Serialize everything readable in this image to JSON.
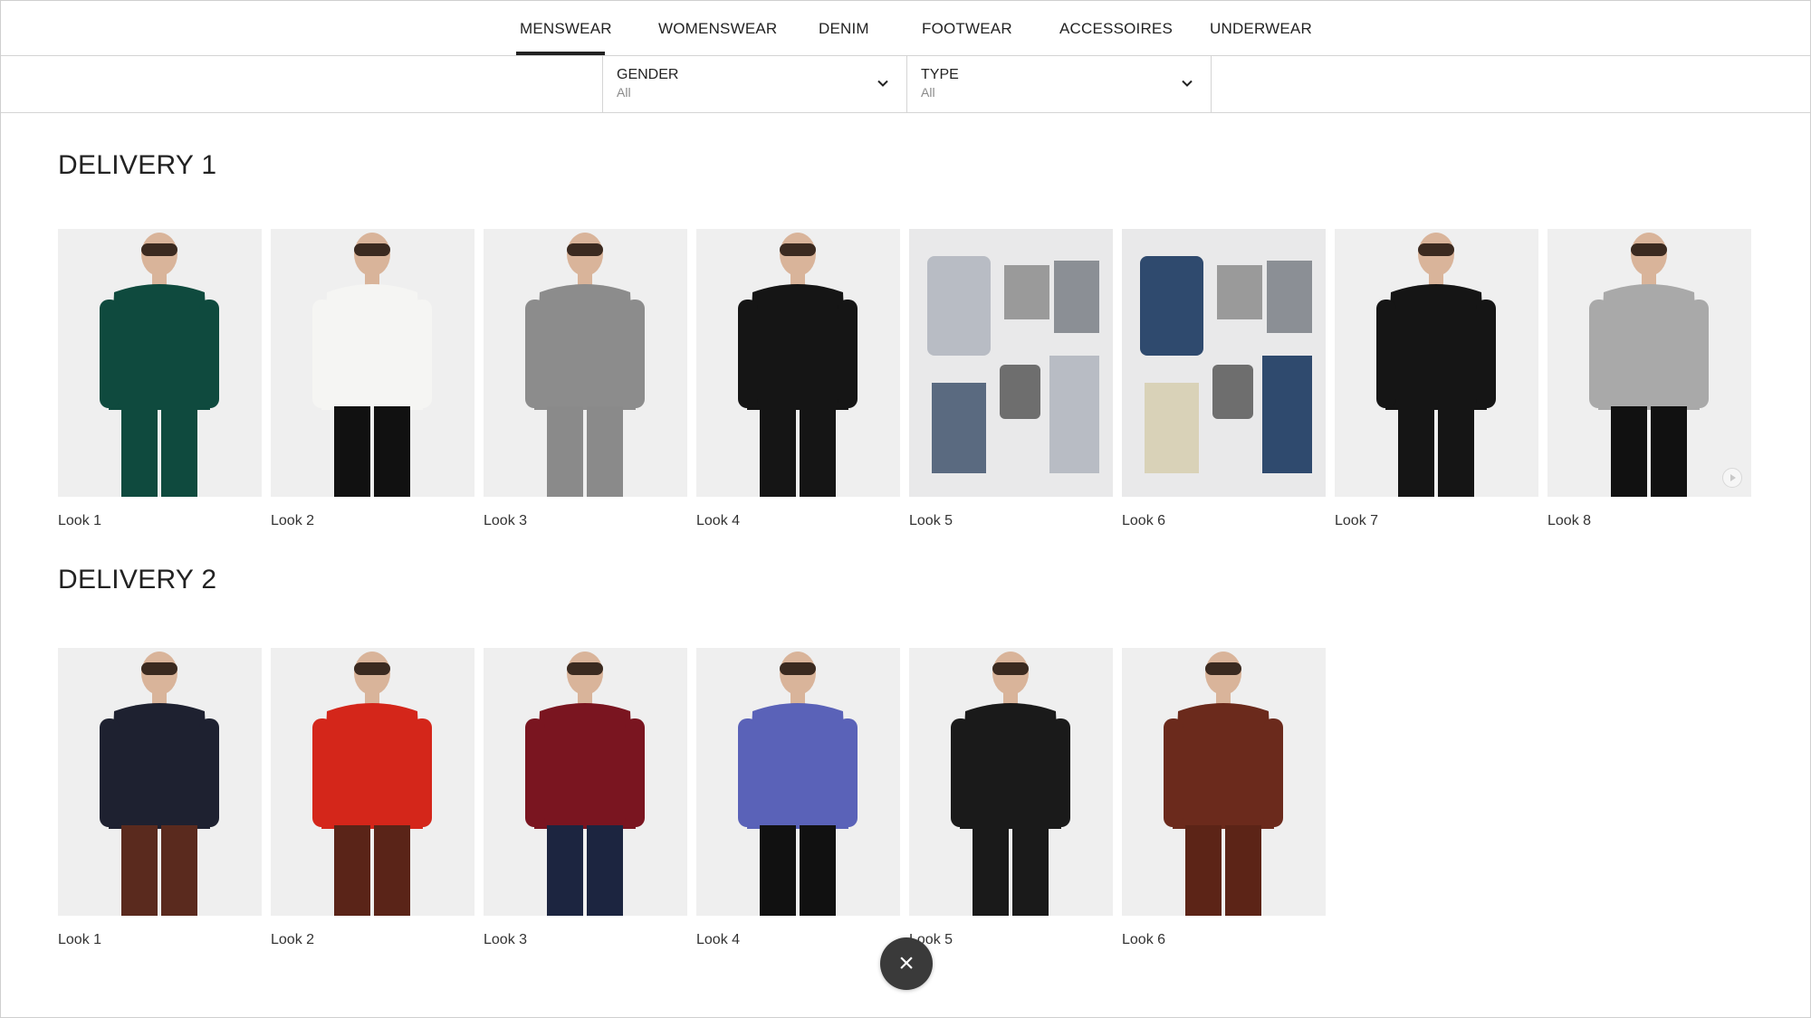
{
  "nav": {
    "tabs": [
      {
        "label": "MENSWEAR",
        "active": true
      },
      {
        "label": "WOMENSWEAR",
        "active": false
      },
      {
        "label": "DENIM",
        "active": false
      },
      {
        "label": "FOOTWEAR",
        "active": false
      },
      {
        "label": "ACCESSOIRES",
        "active": false
      },
      {
        "label": "UNDERWEAR",
        "active": false
      }
    ]
  },
  "filters": [
    {
      "label": "GENDER",
      "value": "All",
      "icon": "chevron-down-icon"
    },
    {
      "label": "TYPE",
      "value": "All",
      "icon": "chevron-down-icon"
    }
  ],
  "sections": [
    {
      "title": "DELIVERY 1",
      "looks": [
        {
          "label": "Look 1",
          "garment": "green double-breasted suit",
          "colors": [
            "#0f4a3e",
            "#0f4a3e"
          ]
        },
        {
          "label": "Look 2",
          "garment": "white shirt, black trousers",
          "colors": [
            "#f5f5f3",
            "#111111"
          ]
        },
        {
          "label": "Look 3",
          "garment": "grey check double-breasted suit",
          "colors": [
            "#8c8c8c",
            "#8a8a8a"
          ]
        },
        {
          "label": "Look 4",
          "garment": "black polo",
          "colors": [
            "#151515",
            "#151515"
          ]
        },
        {
          "label": "Look 5",
          "garment": "flat-lay: jacket, tees, bag, jeans",
          "colors": [
            "#b8bcc4",
            "#5a6a80"
          ]
        },
        {
          "label": "Look 6",
          "garment": "flat-lay: denim jeans, tote bag",
          "colors": [
            "#2f4a6e",
            "#d9d2b8"
          ]
        },
        {
          "label": "Look 7",
          "garment": "black polo",
          "colors": [
            "#151515",
            "#151515"
          ]
        },
        {
          "label": "Look 8",
          "garment": "grey hoodie",
          "colors": [
            "#a9a9a9",
            "#111111"
          ],
          "has_play": true
        }
      ]
    },
    {
      "title": "DELIVERY 2",
      "looks": [
        {
          "label": "Look 1",
          "garment": "navy coat",
          "colors": [
            "#1e2130",
            "#5a2a1e"
          ]
        },
        {
          "label": "Look 2",
          "garment": "red top, brown leather trousers",
          "colors": [
            "#d4261a",
            "#5a2418"
          ]
        },
        {
          "label": "Look 3",
          "garment": "burgundy sweater with yellow stripe",
          "colors": [
            "#7a1520",
            "#1c2540"
          ]
        },
        {
          "label": "Look 4",
          "garment": "blue patterned knit",
          "colors": [
            "#5a62b8",
            "#111111"
          ]
        },
        {
          "label": "Look 5",
          "garment": "black leather shirt",
          "colors": [
            "#1a1a1a",
            "#1a1a1a"
          ]
        },
        {
          "label": "Look 6",
          "garment": "brown leather shirt",
          "colors": [
            "#6b2a1c",
            "#5c2417"
          ]
        }
      ]
    }
  ],
  "close_button": {
    "symbol": "×"
  }
}
